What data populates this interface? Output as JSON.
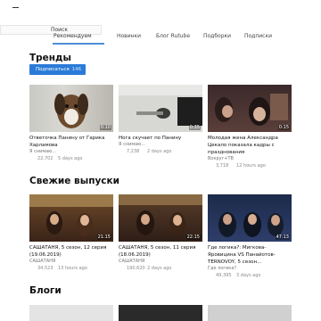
{
  "search": {
    "label": "Поиск"
  },
  "tabs": [
    {
      "label": "Рекомендуем",
      "active": true
    },
    {
      "label": "Новинки"
    },
    {
      "label": "Блог Rutube"
    },
    {
      "label": "Подборки"
    },
    {
      "label": "Подписки"
    }
  ],
  "trends": {
    "title": "Тренды",
    "subscribe_label": "Подписаться",
    "subscribe_count": "146",
    "cards": [
      {
        "title": "Ответочка Панину от Гарика Харламова",
        "author": "Я снимаю...",
        "views": "22,702",
        "age": "5 days ago",
        "duration": "0:10"
      },
      {
        "title": "Нога скучает по Панину",
        "author": "Я снимаю...",
        "views": "7,238",
        "age": "2 days ago",
        "duration": "0:35"
      },
      {
        "title": "Молодая жена Александра Цекало показала кадры с празднования",
        "author": "Вокруг+ТВ",
        "views": "3,718",
        "age": "12 hours ago",
        "duration": "0:15"
      }
    ]
  },
  "fresh": {
    "title": "Свежие выпуски",
    "cards": [
      {
        "title": "САШАТАНЯ, 5 сезон, 12 серия (19.06.2019)",
        "author": "САШАТАНЯ",
        "views": "34,523",
        "age": "13 hours ago",
        "duration": "21:15"
      },
      {
        "title": "САШАТАНЯ, 5 сезон, 11 серия (18.06.2019)",
        "author": "САШАТАНЯ",
        "views": "190,620",
        "age": "2 days ago",
        "duration": "22:15"
      },
      {
        "title": "Где логика?: Мигкова-Яровицина VS Панайотов-TERNOVOY, 5 сезон...",
        "author": "Где логика?",
        "views": "49,395",
        "age": "3 days ago",
        "duration": "47:13"
      }
    ]
  },
  "blogs": {
    "title": "Блоги"
  }
}
